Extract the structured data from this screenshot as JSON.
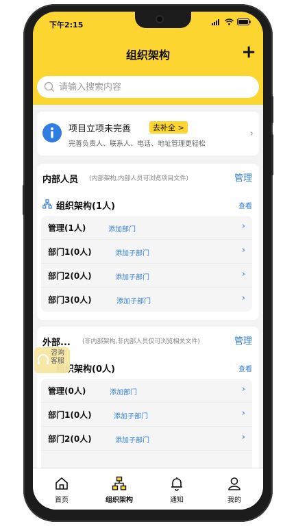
{
  "status": {
    "time": "下午2:15"
  },
  "header": {
    "title": "组织架构",
    "add_icon": "plus-icon"
  },
  "search": {
    "placeholder": "请输入搜索内容"
  },
  "notice": {
    "title": "项目立项未完善",
    "action": "去补全 >",
    "subtitle": "完善负责人、联系人、电话、地址管理更轻松"
  },
  "internal": {
    "title": "内部人员",
    "note": "(内部架构,内部人员可浏览项目文件)",
    "manage": "管理",
    "org_title": "组织架构(1人)",
    "view": "查看",
    "rows": [
      {
        "name": "管理(1人)",
        "action": "添加部门"
      },
      {
        "name": "部门1(0人)",
        "action": "添加子部门"
      },
      {
        "name": "部门2(0人)",
        "action": "添加子部门"
      },
      {
        "name": "部门3(0人)",
        "action": "添加子部门"
      }
    ]
  },
  "external": {
    "title": "外部...",
    "note": "(非内部架构,非内部人员仅可浏览相关文件)",
    "manage": "管理",
    "org_title": "组织架构(0人)",
    "view": "查看",
    "rows": [
      {
        "name": "管理(0人)",
        "action": "添加部门"
      },
      {
        "name": "部门1(0人)",
        "action": "添加子部门"
      },
      {
        "name": "部门2(0人)",
        "action": "添加子部门"
      }
    ]
  },
  "consult": {
    "line1": "咨询",
    "line2": "客服"
  },
  "tabs": [
    {
      "label": "首页",
      "icon": "home-icon"
    },
    {
      "label": "组织架构",
      "icon": "org-chart-icon"
    },
    {
      "label": "通知",
      "icon": "bell-icon"
    },
    {
      "label": "我的",
      "icon": "user-icon"
    }
  ],
  "colors": {
    "brand_yellow": "#fcd530",
    "link_blue": "#2f7de1",
    "info_blue": "#2f7de1"
  }
}
